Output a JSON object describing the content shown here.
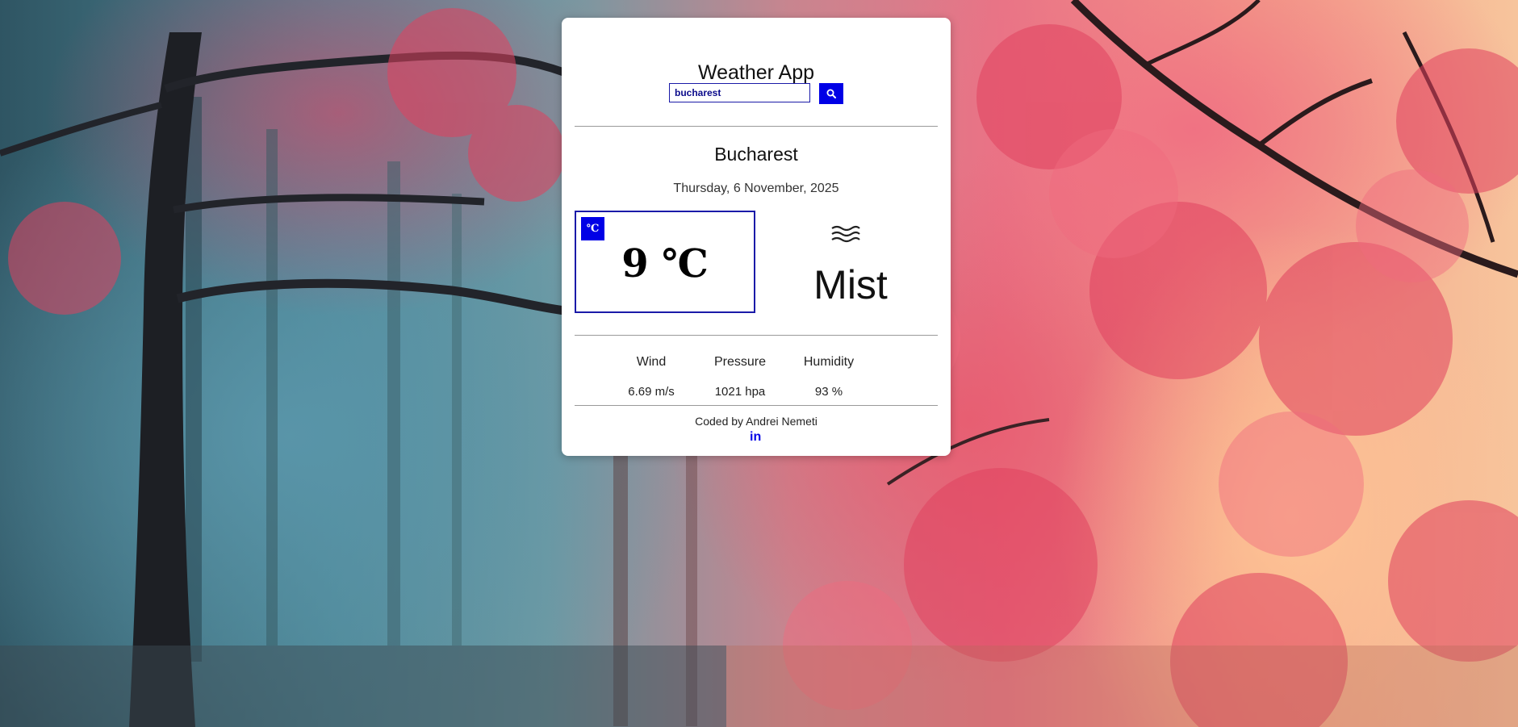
{
  "app": {
    "title": "Weather App"
  },
  "search": {
    "value": "bucharest",
    "button_icon": "search-icon"
  },
  "location": {
    "city": "Bucharest",
    "date": "Thursday, 6 November, 2025"
  },
  "current": {
    "unit_toggle_label": "℃",
    "temperature": "9 ℃",
    "condition": "Mist",
    "condition_icon": "mist-icon"
  },
  "stats": {
    "wind_label": "Wind",
    "wind_value": "6.69 m/s",
    "pressure_label": "Pressure",
    "pressure_value": "1021 hpa",
    "humidity_label": "Humidity",
    "humidity_value": "93 %"
  },
  "footer": {
    "credit": "Coded by Andrei Nemeti",
    "social_icon": "linkedin-icon",
    "social_label": "in"
  },
  "colors": {
    "accent": "#0000e6",
    "border": "#1a1aa8"
  }
}
